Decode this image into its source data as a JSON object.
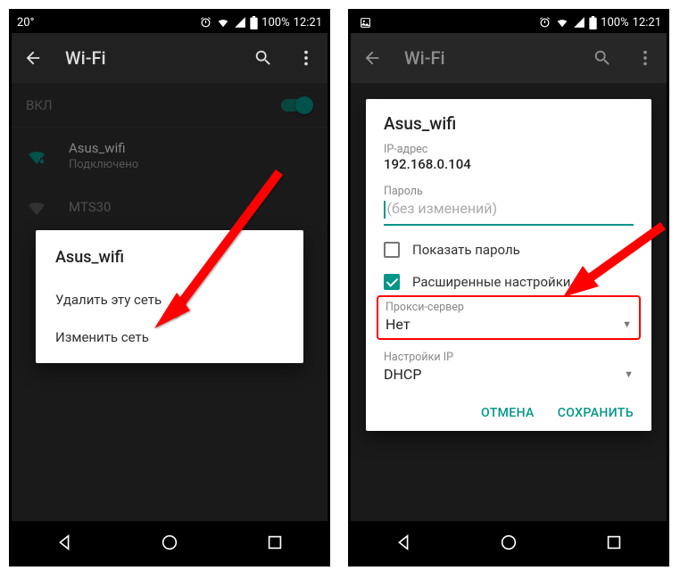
{
  "status": {
    "temp": "20°",
    "battery": "100%",
    "time": "12:21"
  },
  "appbar": {
    "title": "Wi-Fi"
  },
  "left": {
    "toggle_label": "ВКЛ",
    "network1_name": "Asus_wifi",
    "network1_sub": "Подключено",
    "network2_name": "MTS30",
    "dialog_title": "Asus_wifi",
    "opt_forget": "Удалить эту сеть",
    "opt_modify": "Изменить сеть"
  },
  "right": {
    "dialog_title": "Asus_wifi",
    "ip_label": "IP-адрес",
    "ip_value": "192.168.0.104",
    "pw_label": "Пароль",
    "pw_placeholder": "(без изменений)",
    "show_pw": "Показать пароль",
    "advanced": "Расширенные настройки",
    "proxy_label": "Прокси-сервер",
    "proxy_value": "Нет",
    "ipcfg_label": "Настройки IP",
    "ipcfg_value": "DHCP",
    "cancel": "ОТМЕНА",
    "save": "СОХРАНИТЬ"
  }
}
